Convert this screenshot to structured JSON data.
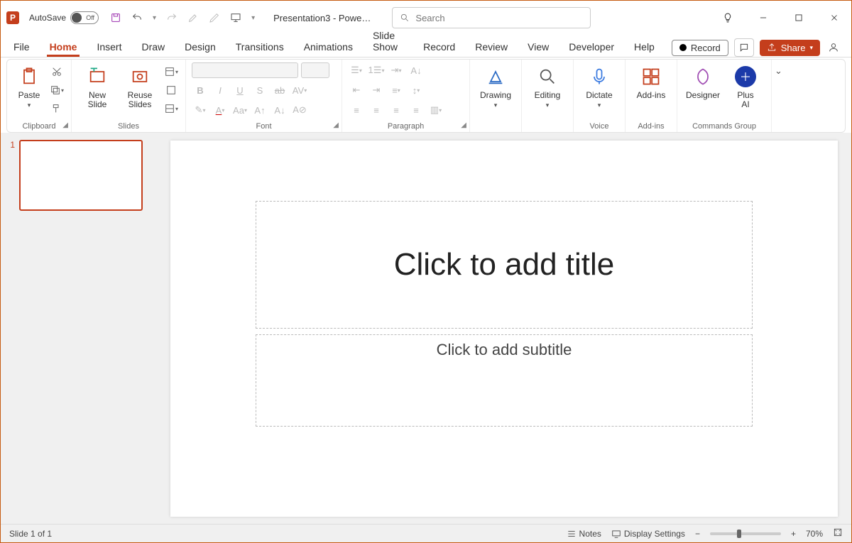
{
  "titlebar": {
    "autosave_label": "AutoSave",
    "autosave_state": "Off",
    "doc_title": "Presentation3 - Powe…",
    "search_placeholder": "Search"
  },
  "tabs": {
    "items": [
      "File",
      "Home",
      "Insert",
      "Draw",
      "Design",
      "Transitions",
      "Animations",
      "Slide Show",
      "Record",
      "Review",
      "View",
      "Developer",
      "Help"
    ],
    "active_index": 1,
    "record_label": "Record",
    "share_label": "Share"
  },
  "ribbon": {
    "clipboard": {
      "paste": "Paste",
      "label": "Clipboard"
    },
    "slides": {
      "new_slide": "New\nSlide",
      "reuse": "Reuse\nSlides",
      "label": "Slides"
    },
    "font": {
      "label": "Font"
    },
    "paragraph": {
      "label": "Paragraph"
    },
    "drawing": {
      "btn": "Drawing",
      "label": ""
    },
    "editing": {
      "btn": "Editing",
      "label": ""
    },
    "voice": {
      "btn": "Dictate",
      "label": "Voice"
    },
    "addins": {
      "btn": "Add-ins",
      "label": "Add-ins"
    },
    "designer": {
      "btn": "Designer"
    },
    "plusai": {
      "line1": "Plus",
      "line2": "AI"
    },
    "commands_label": "Commands Group"
  },
  "slide": {
    "thumb_number": "1",
    "title_placeholder": "Click to add title",
    "subtitle_placeholder": "Click to add subtitle"
  },
  "status": {
    "slide_counter": "Slide 1 of 1",
    "notes": "Notes",
    "display_settings": "Display Settings",
    "zoom": "70%"
  }
}
